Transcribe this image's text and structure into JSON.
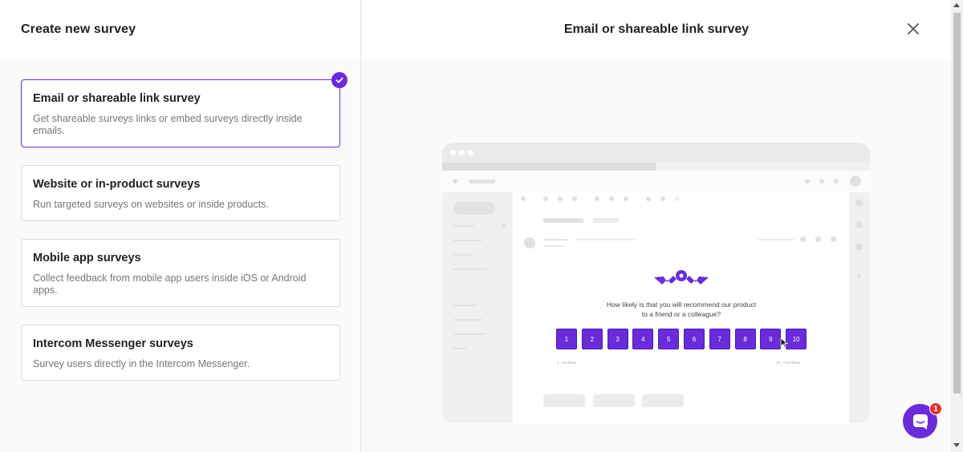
{
  "left_panel": {
    "title": "Create new survey",
    "options": [
      {
        "title": "Email or shareable link survey",
        "description": "Get shareable surveys links or embed surveys directly inside emails.",
        "selected": true
      },
      {
        "title": "Website or in-product surveys",
        "description": "Run targeted surveys on websites or inside products.",
        "selected": false
      },
      {
        "title": "Mobile app surveys",
        "description": "Collect feedback from mobile app users inside iOS or Android apps.",
        "selected": false
      },
      {
        "title": "Intercom Messenger surveys",
        "description": "Survey users directly in the Intercom Messenger.",
        "selected": false
      }
    ]
  },
  "right_panel": {
    "title": "Email or shareable link survey",
    "close_icon": "close-icon"
  },
  "preview": {
    "question_line1": "How likely is that you will recommend our product",
    "question_line2": "to a friend or a colleague?",
    "scale": [
      "1",
      "2",
      "3",
      "4",
      "5",
      "6",
      "7",
      "8",
      "9",
      "10"
    ],
    "low_label": "1 - not likely",
    "high_label": "10 - most likely"
  },
  "messenger": {
    "badge_count": "1"
  },
  "colors": {
    "accent": "#6a2bd9",
    "badge": "#e0312c"
  }
}
